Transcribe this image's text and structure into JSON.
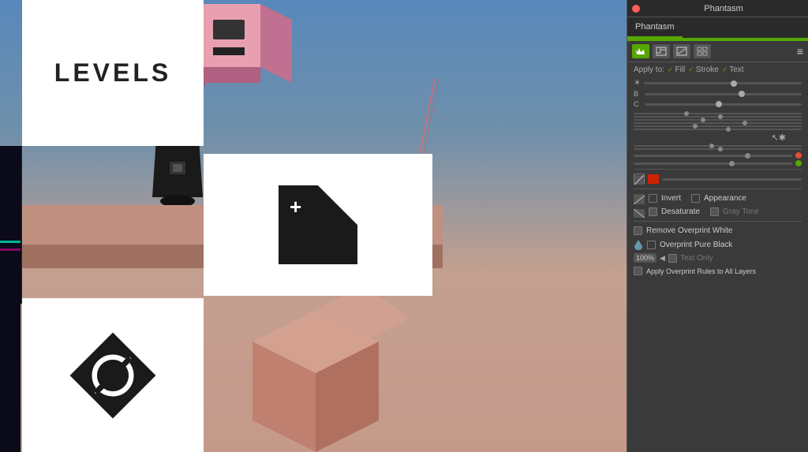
{
  "app": {
    "title": "Phantasm"
  },
  "panel": {
    "title": "Phantasm",
    "close_btn": "×",
    "tab_label": "Phantasm",
    "menu_icon": "≡",
    "toolbar_icons": [
      "crown-icon",
      "levels-icon",
      "curves-icon",
      "grid-icon"
    ],
    "apply_to_label": "Apply to:",
    "apply_fill": "Fill",
    "apply_stroke": "Stroke",
    "apply_text": "Text",
    "slider_b_label": "B",
    "slider_c_label": "C",
    "invert_label": "Invert",
    "appearance_label": "Appearance",
    "desaturate_label": "Desaturate",
    "gray_tone_label": "Gray Tone",
    "remove_overprint_white_label": "Remove Overprint White",
    "overprint_pure_black_label": "Overprint Pure Black",
    "percent_label": "100%",
    "text_only_label": "Text Only",
    "apply_rules_label": "Apply Overprint Rules to All Layers"
  },
  "levels_card": {
    "text": "LEVELS"
  },
  "colors": {
    "accent_green": "#56a600",
    "accent_red": "#e05030",
    "panel_bg": "#3a3a3a",
    "panel_dark": "#2a2a2a"
  }
}
